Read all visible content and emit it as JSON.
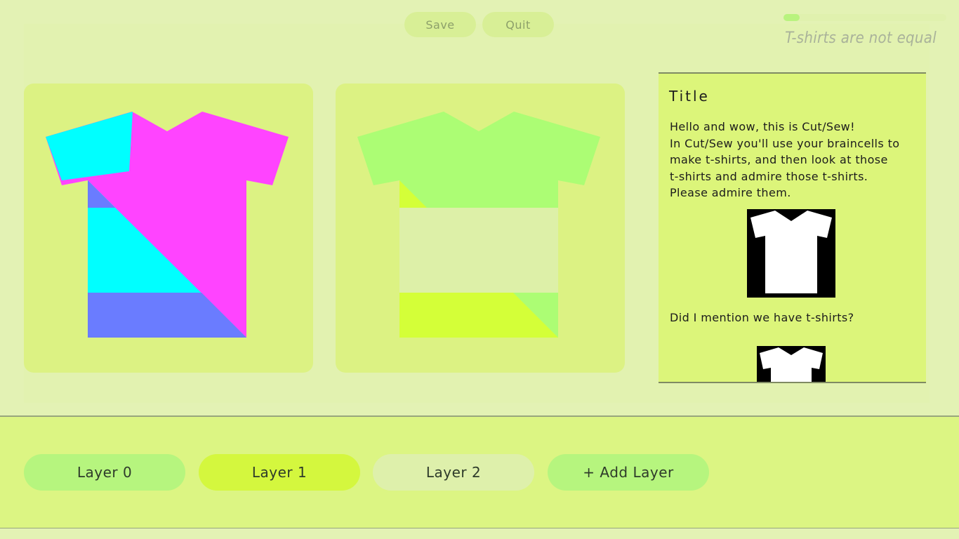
{
  "toolbar": {
    "save_label": "Save",
    "quit_label": "Quit"
  },
  "progress": {
    "fraction": 0.1
  },
  "status_text": "T-shirts are not equal",
  "info_panel": {
    "title": "Title",
    "lines": [
      "Hello and wow, this is Cut/Sew!",
      "In Cut/Sew you'll use your braincells to",
      "make t-shirts, and then look at those",
      "t-shirts and admire those t-shirts.",
      "Please admire them."
    ],
    "mention": "Did I mention we have t-shirts?"
  },
  "layers": [
    {
      "label": "Layer 0",
      "color": "#b6f57e"
    },
    {
      "label": "Layer 1",
      "color": "#d4f73e"
    },
    {
      "label": "Layer 2",
      "color": "#def0ab"
    },
    {
      "label": "+ Add Layer",
      "color": "#b6f57e"
    }
  ],
  "colors": {
    "cyan": "#00ffff",
    "magenta": "#ff44ff",
    "periwinkle": "#6a7cff",
    "light_green": "#acfd74",
    "lime": "#d4ff38",
    "pale": "#ddf0a8"
  }
}
